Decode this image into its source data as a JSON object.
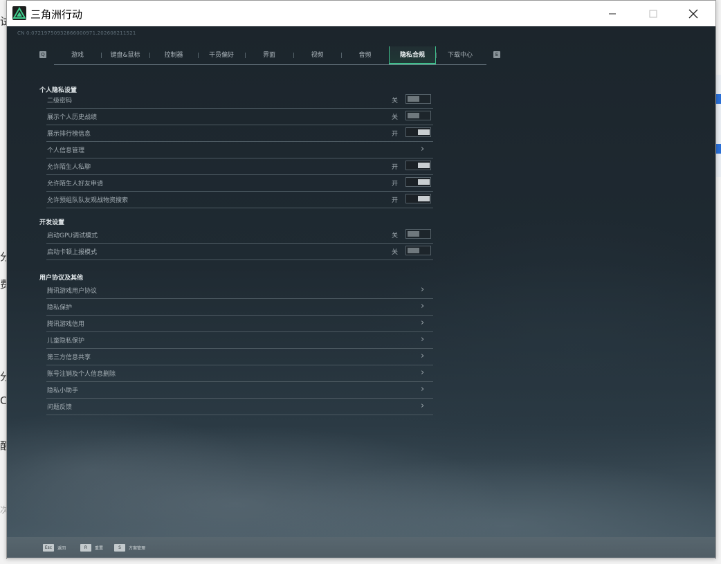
{
  "window": {
    "title": "三角洲行动"
  },
  "build_id": "CN 0:07219750932866000971.202608211521",
  "tabs": {
    "left_key": "Q",
    "right_key": "E",
    "items": [
      {
        "label": "游戏"
      },
      {
        "label": "键盘&鼠标"
      },
      {
        "label": "控制器"
      },
      {
        "label": "干员偏好"
      },
      {
        "label": "界面"
      },
      {
        "label": "视频"
      },
      {
        "label": "音频"
      },
      {
        "label": "隐私合规",
        "active": true
      },
      {
        "label": "下载中心"
      }
    ]
  },
  "sections": {
    "privacy": {
      "title": "个人隐私设置",
      "rows": [
        {
          "label": "二级密码",
          "state": "关"
        },
        {
          "label": "展示个人历史战绩",
          "state": "关"
        },
        {
          "label": "展示排行榜信息",
          "state": "开"
        },
        {
          "label": "个人信息管理"
        },
        {
          "label": "允许陌生人私聊",
          "state": "开"
        },
        {
          "label": "允许陌生人好友申请",
          "state": "开"
        },
        {
          "label": "允许预组队队友观战物资搜索",
          "state": "开"
        }
      ]
    },
    "dev": {
      "title": "开发设置",
      "rows": [
        {
          "label": "启动GPU调试模式",
          "state": "关"
        },
        {
          "label": "启动卡顿上报模式",
          "state": "关"
        }
      ]
    },
    "agreements": {
      "title": "用户协议及其他",
      "rows": [
        {
          "label": "腾讯游戏用户协议"
        },
        {
          "label": "隐私保护"
        },
        {
          "label": "腾讯游戏信用"
        },
        {
          "label": "儿童隐私保护"
        },
        {
          "label": "第三方信息共享"
        },
        {
          "label": "账号注销及个人信息删除"
        },
        {
          "label": "隐私小助手"
        },
        {
          "label": "问题反馈"
        }
      ]
    }
  },
  "footer": {
    "items": [
      {
        "key": "Esc",
        "label": "返回"
      },
      {
        "key": "R",
        "label": "重置"
      },
      {
        "key": "S",
        "label": "方案管理"
      }
    ]
  },
  "background": {
    "left_glyphs": [
      "试",
      "分",
      "费",
      "分",
      "C",
      "醒",
      "次"
    ]
  },
  "colors": {
    "accent": "#3fbf8c"
  }
}
